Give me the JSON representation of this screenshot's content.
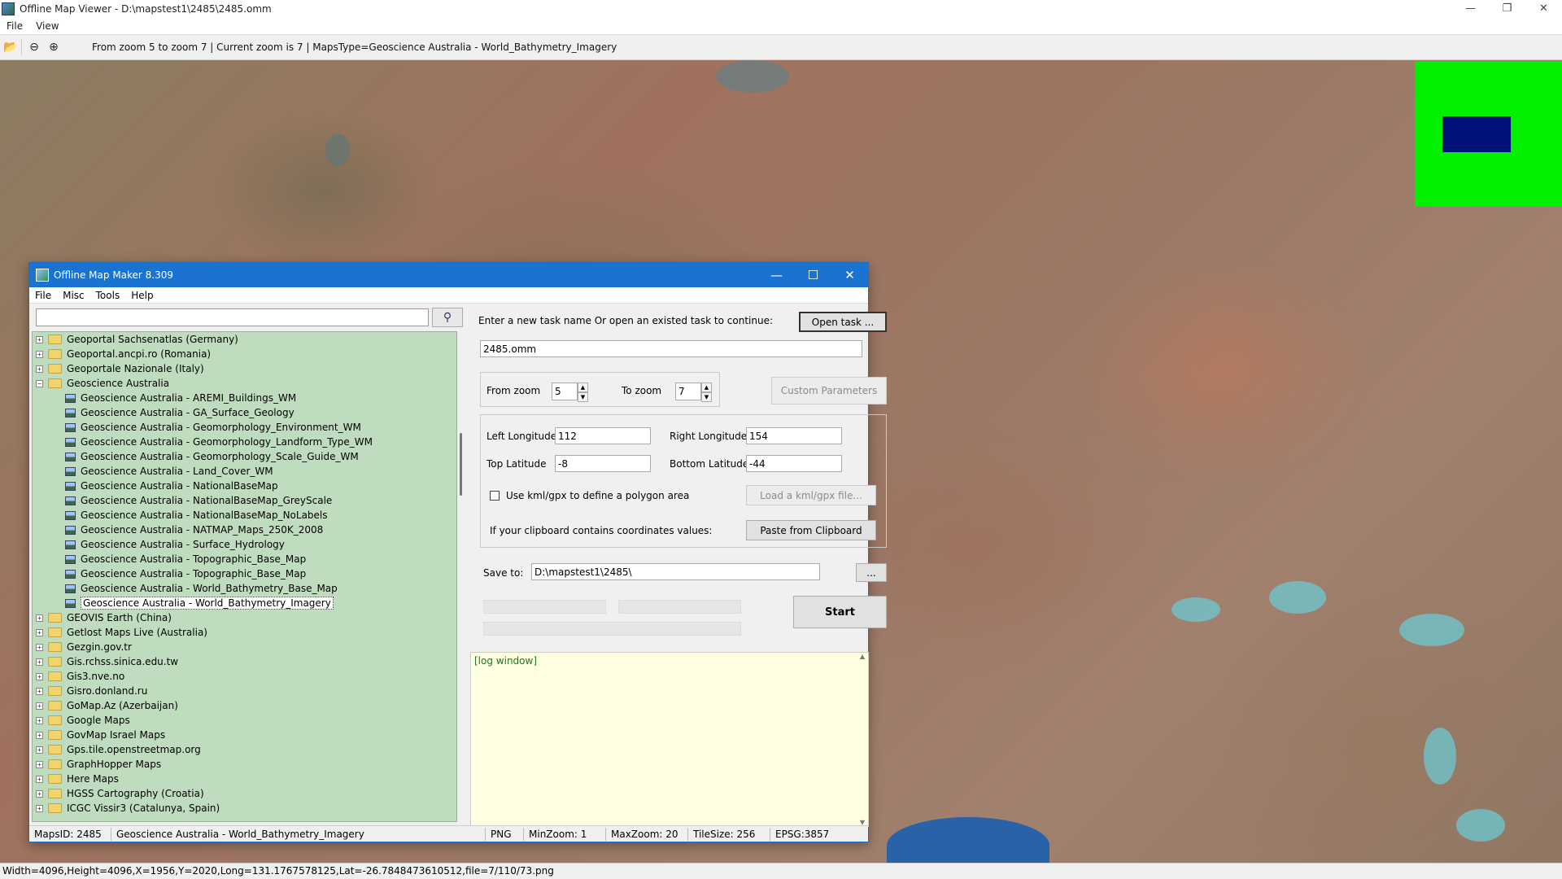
{
  "viewer": {
    "title": "Offline Map Viewer - D:\\mapstest1\\2485\\2485.omm",
    "menu": [
      "File",
      "View"
    ],
    "toolbar_info": "From zoom 5 to zoom 7   |   Current zoom is 7  |    MapsType=Geoscience Australia - World_Bathymetry_Imagery",
    "status": "Width=4096,Height=4096,X=1956,Y=2020,Long=131.1767578125,Lat=-26.7848473610512,file=7/110/73.png",
    "minimap_color": "#00f000",
    "minimap_view_color": "#00117a"
  },
  "maker": {
    "title": "Offline Map Maker 8.309",
    "menu": [
      "File",
      "Misc",
      "Tools",
      "Help"
    ],
    "search": {
      "value": "",
      "placeholder": ""
    },
    "tree": {
      "before": [
        "Geoportal Sachsenatlas (Germany)",
        "Geoportal.ancpi.ro (Romania)",
        "Geoportale Nazionale (Italy)"
      ],
      "expanded": "Geoscience Australia",
      "children": [
        "Geoscience Australia - AREMI_Buildings_WM",
        "Geoscience Australia - GA_Surface_Geology",
        "Geoscience Australia - Geomorphology_Environment_WM",
        "Geoscience Australia - Geomorphology_Landform_Type_WM",
        "Geoscience Australia - Geomorphology_Scale_Guide_WM",
        "Geoscience Australia - Land_Cover_WM",
        "Geoscience Australia - NationalBaseMap",
        "Geoscience Australia - NationalBaseMap_GreyScale",
        "Geoscience Australia - NationalBaseMap_NoLabels",
        "Geoscience Australia - NATMAP_Maps_250K_2008",
        "Geoscience Australia - Surface_Hydrology",
        "Geoscience Australia - Topographic_Base_Map",
        "Geoscience Australia - Topographic_Base_Map",
        "Geoscience Australia - World_Bathymetry_Base_Map",
        "Geoscience Australia - World_Bathymetry_Imagery"
      ],
      "selected": "Geoscience Australia - World_Bathymetry_Imagery",
      "after": [
        "GEOVIS Earth (China)",
        "Getlost Maps Live (Australia)",
        "Gezgin.gov.tr",
        "Gis.rchss.sinica.edu.tw",
        "Gis3.nve.no",
        "Gisro.donland.ru",
        "GoMap.Az (Azerbaijan)",
        "Google Maps",
        "GovMap Israel Maps",
        "Gps.tile.openstreetmap.org",
        "GraphHopper Maps",
        "Here Maps",
        "HGSS Cartography (Croatia)",
        "ICGC Vissir3 (Catalunya, Spain)"
      ]
    },
    "form": {
      "task_prompt": "Enter a new task name Or open an existed task to continue:",
      "open_task_label": "Open task ...",
      "task_name": "2485.omm",
      "from_zoom_label": "From zoom",
      "from_zoom": "5",
      "to_zoom_label": "To zoom",
      "to_zoom": "7",
      "custom_params_label": "Custom Parameters",
      "left_lon_label": "Left Longitude",
      "left_lon": "112",
      "right_lon_label": "Right Longitude",
      "right_lon": "154",
      "top_lat_label": "Top Latitude",
      "top_lat": "-8",
      "bottom_lat_label": "Bottom Latitude",
      "bottom_lat": "-44",
      "kml_check_label": "Use kml/gpx to define a polygon area",
      "load_kml_label": "Load a kml/gpx file...",
      "clipboard_prompt": "If your clipboard contains coordinates values:",
      "paste_label": "Paste from Clipboard",
      "save_to_label": "Save to:",
      "save_to": "D:\\mapstest1\\2485\\",
      "browse_label": "...",
      "start_label": "Start",
      "log_label": "[log window]"
    },
    "status": {
      "maps_id": "MapsID: 2485",
      "maps_name": "Geoscience Australia - World_Bathymetry_Imagery",
      "format": "PNG",
      "min_zoom": "MinZoom: 1",
      "max_zoom": "MaxZoom: 20",
      "tile_size": "TileSize: 256",
      "epsg": "EPSG:3857"
    }
  }
}
